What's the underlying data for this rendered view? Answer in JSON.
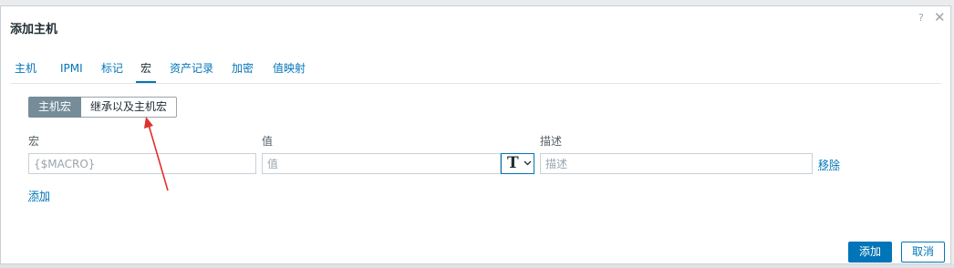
{
  "dialog": {
    "title": "添加主机",
    "help_symbol": "?",
    "close_symbol": "✕"
  },
  "tabs": [
    {
      "label": "主机"
    },
    {
      "label": "IPMI"
    },
    {
      "label": "标记"
    },
    {
      "label": "宏",
      "active": true
    },
    {
      "label": "资产记录"
    },
    {
      "label": "加密"
    },
    {
      "label": "值映射"
    }
  ],
  "macro_scope": {
    "host_macros": "主机宏",
    "inherited_and_host_macros": "继承以及主机宏",
    "selected": "主机宏"
  },
  "columns": {
    "macro": "宏",
    "value": "值",
    "description": "描述"
  },
  "row": {
    "macro_placeholder": "{$MACRO}",
    "value_placeholder": "值",
    "type_symbol": "T",
    "type_icon": "text-type-icon",
    "description_placeholder": "描述",
    "remove_label": "移除"
  },
  "add_link": "添加",
  "footer": {
    "add_button": "添加",
    "cancel_button": "取消"
  },
  "colors": {
    "accent": "#0275b8",
    "active_segment": "#768d99",
    "annotation_arrow": "#e0312f"
  }
}
